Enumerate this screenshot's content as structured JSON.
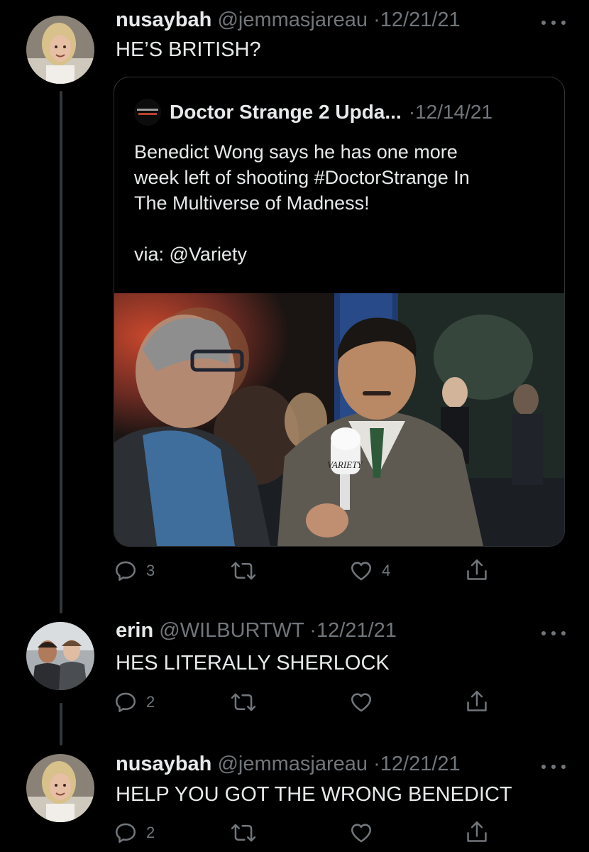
{
  "tweets": [
    {
      "name": "nusaybah",
      "handle": "@jemmasjareau",
      "sep": "·",
      "date": "12/21/21",
      "text": "HE’S BRITISH?",
      "replies": "3",
      "retweets": "",
      "likes": "4"
    },
    {
      "name": "erin",
      "handle": "@WILBURTWT",
      "sep": "·",
      "date": "12/21/21",
      "text": "HES LITERALLY SHERLOCK",
      "replies": "2",
      "retweets": "",
      "likes": ""
    },
    {
      "name": "nusaybah",
      "handle": "@jemmasjareau",
      "sep": "·",
      "date": "12/21/21",
      "text": "HELP YOU GOT THE WRONG BENEDICT",
      "replies": "2",
      "retweets": "",
      "likes": ""
    }
  ],
  "quoted": {
    "avatar_text": "DOCTOR STRANGE",
    "name": "Doctor Strange 2 Upda...",
    "sep": "·",
    "date": "12/14/21",
    "lines": [
      "Benedict Wong says he has one more",
      "week left of shooting #DoctorStrange In",
      "The Multiverse of Madness!",
      "",
      "via: @Variety"
    ],
    "mic_brand": "VARIETY"
  },
  "colors": {
    "background": "#000000",
    "text": "#e7e9ea",
    "muted": "#71767b",
    "border": "#2f3336"
  },
  "icons": [
    "reply-icon",
    "retweet-icon",
    "like-icon",
    "share-icon",
    "more-icon"
  ]
}
